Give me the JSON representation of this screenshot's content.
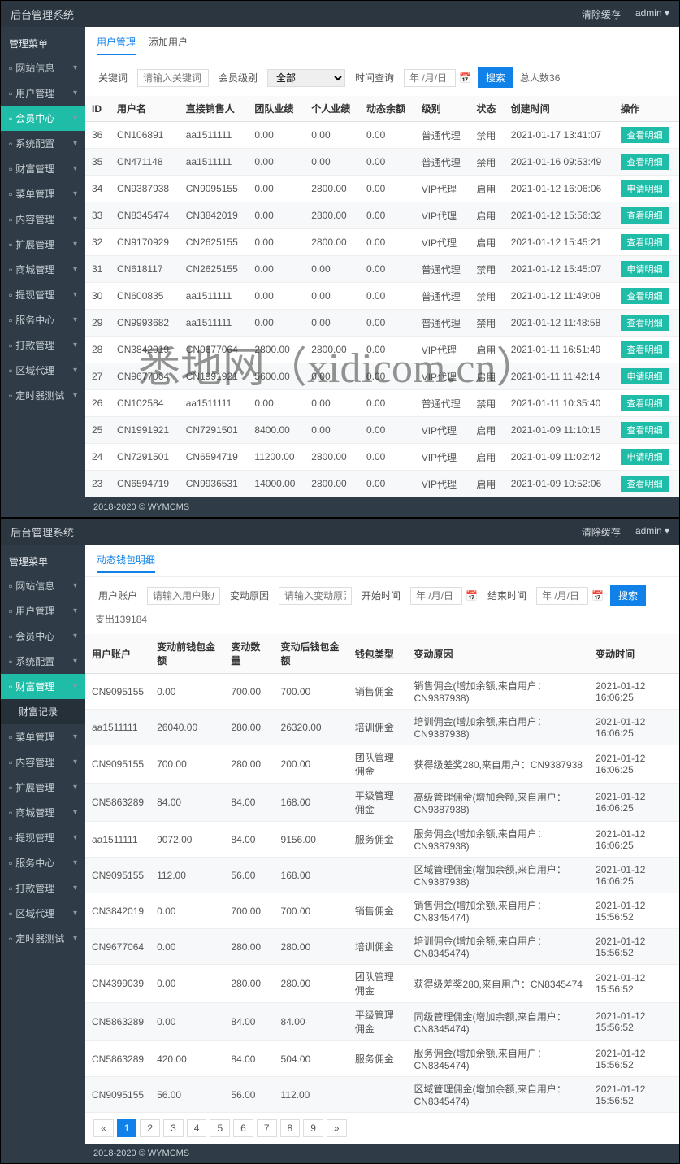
{
  "watermark": "悉地网（xidicom.cn）",
  "topbar": {
    "title": "后台管理系统",
    "clear": "清除缓存",
    "user": "admin"
  },
  "sidebar1": {
    "header": "管理菜单",
    "items": [
      {
        "label": "网站信息",
        "icon": "home-icon"
      },
      {
        "label": "用户管理",
        "icon": "users-icon"
      },
      {
        "label": "会员中心",
        "icon": "member-icon",
        "active": true
      },
      {
        "label": "系统配置",
        "icon": "cog-icon"
      },
      {
        "label": "财富管理",
        "icon": "chart-icon"
      },
      {
        "label": "菜单管理",
        "icon": "list-icon"
      },
      {
        "label": "内容管理",
        "icon": "doc-icon"
      },
      {
        "label": "扩展管理",
        "icon": "plug-icon"
      },
      {
        "label": "商城管理",
        "icon": "cart-icon"
      },
      {
        "label": "提现管理",
        "icon": "money-icon"
      },
      {
        "label": "服务中心",
        "icon": "service-icon"
      },
      {
        "label": "打款管理",
        "icon": "bank-icon"
      },
      {
        "label": "区域代理",
        "icon": "map-icon"
      },
      {
        "label": "定时器测试",
        "icon": "clock-icon"
      }
    ]
  },
  "page1": {
    "tabs": [
      {
        "label": "用户管理",
        "active": true
      },
      {
        "label": "添加用户"
      }
    ],
    "filter": {
      "keyword_label": "关键词",
      "keyword_placeholder": "请输入关键词",
      "level_label": "会员级别",
      "level_value": "全部",
      "time_label": "时间查询",
      "time_placeholder": "年 /月/日",
      "search": "搜索",
      "total": "总人数36"
    },
    "columns": [
      "ID",
      "用户名",
      "直接销售人",
      "团队业绩",
      "个人业绩",
      "动态余额",
      "级别",
      "状态",
      "创建时间",
      "操作"
    ],
    "rows": [
      {
        "id": "36",
        "user": "CN106891",
        "ref": "aa1511111",
        "team": "0.00",
        "pers": "0.00",
        "bal": "0.00",
        "lvl": "普通代理",
        "status": "禁用",
        "time": "2021-01-17 13:41:07",
        "op": "查看明细"
      },
      {
        "id": "35",
        "user": "CN471148",
        "ref": "aa1511111",
        "team": "0.00",
        "pers": "0.00",
        "bal": "0.00",
        "lvl": "普通代理",
        "status": "禁用",
        "time": "2021-01-16 09:53:49",
        "op": "查看明细"
      },
      {
        "id": "34",
        "user": "CN9387938",
        "ref": "CN9095155",
        "team": "0.00",
        "pers": "2800.00",
        "bal": "0.00",
        "lvl": "VIP代理",
        "status": "启用",
        "time": "2021-01-12 16:06:06",
        "op": "申请明细"
      },
      {
        "id": "33",
        "user": "CN8345474",
        "ref": "CN3842019",
        "team": "0.00",
        "pers": "2800.00",
        "bal": "0.00",
        "lvl": "VIP代理",
        "status": "启用",
        "time": "2021-01-12 15:56:32",
        "op": "查看明细"
      },
      {
        "id": "32",
        "user": "CN9170929",
        "ref": "CN2625155",
        "team": "0.00",
        "pers": "2800.00",
        "bal": "0.00",
        "lvl": "VIP代理",
        "status": "启用",
        "time": "2021-01-12 15:45:21",
        "op": "查看明细"
      },
      {
        "id": "31",
        "user": "CN618117",
        "ref": "CN2625155",
        "team": "0.00",
        "pers": "0.00",
        "bal": "0.00",
        "lvl": "普通代理",
        "status": "禁用",
        "time": "2021-01-12 15:45:07",
        "op": "申请明细"
      },
      {
        "id": "30",
        "user": "CN600835",
        "ref": "aa1511111",
        "team": "0.00",
        "pers": "0.00",
        "bal": "0.00",
        "lvl": "普通代理",
        "status": "禁用",
        "time": "2021-01-12 11:49:08",
        "op": "查看明细"
      },
      {
        "id": "29",
        "user": "CN9993682",
        "ref": "aa1511111",
        "team": "0.00",
        "pers": "0.00",
        "bal": "0.00",
        "lvl": "普通代理",
        "status": "禁用",
        "time": "2021-01-12 11:48:58",
        "op": "查看明细"
      },
      {
        "id": "28",
        "user": "CN3842019",
        "ref": "CN9677064",
        "team": "2800.00",
        "pers": "2800.00",
        "bal": "0.00",
        "lvl": "VIP代理",
        "status": "启用",
        "time": "2021-01-11 16:51:49",
        "op": "查看明细"
      },
      {
        "id": "27",
        "user": "CN9677064",
        "ref": "CN1991921",
        "team": "5600.00",
        "pers": "0.00",
        "bal": "0.00",
        "lvl": "VIP代理",
        "status": "启用",
        "time": "2021-01-11 11:42:14",
        "op": "申请明细"
      },
      {
        "id": "26",
        "user": "CN102584",
        "ref": "aa1511111",
        "team": "0.00",
        "pers": "0.00",
        "bal": "0.00",
        "lvl": "普通代理",
        "status": "禁用",
        "time": "2021-01-11 10:35:40",
        "op": "查看明细"
      },
      {
        "id": "25",
        "user": "CN1991921",
        "ref": "CN7291501",
        "team": "8400.00",
        "pers": "0.00",
        "bal": "0.00",
        "lvl": "VIP代理",
        "status": "启用",
        "time": "2021-01-09 11:10:15",
        "op": "查看明细"
      },
      {
        "id": "24",
        "user": "CN7291501",
        "ref": "CN6594719",
        "team": "11200.00",
        "pers": "2800.00",
        "bal": "0.00",
        "lvl": "VIP代理",
        "status": "启用",
        "time": "2021-01-09 11:02:42",
        "op": "申请明细"
      },
      {
        "id": "23",
        "user": "CN6594719",
        "ref": "CN9936531",
        "team": "14000.00",
        "pers": "2800.00",
        "bal": "0.00",
        "lvl": "VIP代理",
        "status": "启用",
        "time": "2021-01-09 10:52:06",
        "op": "查看明细"
      }
    ],
    "footer": "2018-2020 © WYMCMS"
  },
  "sidebar2": {
    "header": "管理菜单",
    "items": [
      {
        "label": "网站信息",
        "icon": "home-icon"
      },
      {
        "label": "用户管理",
        "icon": "users-icon"
      },
      {
        "label": "会员中心",
        "icon": "member-icon"
      },
      {
        "label": "系统配置",
        "icon": "cog-icon"
      },
      {
        "label": "财富管理",
        "icon": "chart-icon",
        "active": true
      },
      {
        "label": "菜单管理",
        "icon": "list-icon"
      },
      {
        "label": "内容管理",
        "icon": "doc-icon"
      },
      {
        "label": "扩展管理",
        "icon": "plug-icon"
      },
      {
        "label": "商城管理",
        "icon": "cart-icon"
      },
      {
        "label": "提现管理",
        "icon": "money-icon"
      },
      {
        "label": "服务中心",
        "icon": "service-icon"
      },
      {
        "label": "打款管理",
        "icon": "bank-icon"
      },
      {
        "label": "区域代理",
        "icon": "map-icon"
      },
      {
        "label": "定时器测试",
        "icon": "clock-icon"
      }
    ],
    "sub": "财富记录"
  },
  "page2": {
    "tabs": [
      {
        "label": "动态钱包明细",
        "active": true
      }
    ],
    "filter": {
      "account_label": "用户账户",
      "account_placeholder": "请输入用户账户",
      "reason_label": "变动原因",
      "reason_placeholder": "请输入变动原因",
      "start_label": "开始时间",
      "time_placeholder": "年 /月/日",
      "end_label": "结束时间",
      "search": "搜索",
      "total": "支出139184"
    },
    "columns": [
      "用户账户",
      "变动前钱包金额",
      "变动数量",
      "变动后钱包金额",
      "钱包类型",
      "变动原因",
      "变动时间"
    ],
    "rows": [
      {
        "u": "CN9095155",
        "before": "0.00",
        "diff": "700.00",
        "after": "700.00",
        "type": "销售佣金",
        "reason": "销售佣金(增加余额,来自用户：CN9387938)",
        "time": "2021-01-12 16:06:25"
      },
      {
        "u": "aa1511111",
        "before": "26040.00",
        "diff": "280.00",
        "after": "26320.00",
        "type": "培训佣金",
        "reason": "培训佣金(增加余额,来自用户：CN9387938)",
        "time": "2021-01-12 16:06:25"
      },
      {
        "u": "CN9095155",
        "before": "700.00",
        "diff": "280.00",
        "after": "200.00",
        "type": "团队管理佣金",
        "reason": "获得级差奖280,来自用户：CN9387938",
        "time": "2021-01-12 16:06:25"
      },
      {
        "u": "CN5863289",
        "before": "84.00",
        "diff": "84.00",
        "after": "168.00",
        "type": "平级管理佣金",
        "reason": "高级管理佣金(增加余额,来自用户：CN9387938)",
        "time": "2021-01-12 16:06:25"
      },
      {
        "u": "aa1511111",
        "before": "9072.00",
        "diff": "84.00",
        "after": "9156.00",
        "type": "服务佣金",
        "reason": "服务佣金(增加余额,来自用户：CN9387938)",
        "time": "2021-01-12 16:06:25"
      },
      {
        "u": "CN9095155",
        "before": "112.00",
        "diff": "56.00",
        "after": "168.00",
        "type": "",
        "reason": "区域管理佣金(增加余额,来自用户：CN9387938)",
        "time": "2021-01-12 16:06:25"
      },
      {
        "u": "CN3842019",
        "before": "0.00",
        "diff": "700.00",
        "after": "700.00",
        "type": "销售佣金",
        "reason": "销售佣金(增加余额,来自用户：CN8345474)",
        "time": "2021-01-12 15:56:52"
      },
      {
        "u": "CN9677064",
        "before": "0.00",
        "diff": "280.00",
        "after": "280.00",
        "type": "培训佣金",
        "reason": "培训佣金(增加余额,来自用户：CN8345474)",
        "time": "2021-01-12 15:56:52"
      },
      {
        "u": "CN4399039",
        "before": "0.00",
        "diff": "280.00",
        "after": "280.00",
        "type": "团队管理佣金",
        "reason": "获得级差奖280,来自用户：CN8345474",
        "time": "2021-01-12 15:56:52"
      },
      {
        "u": "CN5863289",
        "before": "0.00",
        "diff": "84.00",
        "after": "84.00",
        "type": "平级管理佣金",
        "reason": "同级管理佣金(增加余额,来自用户：CN8345474)",
        "time": "2021-01-12 15:56:52"
      },
      {
        "u": "CN5863289",
        "before": "420.00",
        "diff": "84.00",
        "after": "504.00",
        "type": "服务佣金",
        "reason": "服务佣金(增加余额,来自用户：CN8345474)",
        "time": "2021-01-12 15:56:52"
      },
      {
        "u": "CN9095155",
        "before": "56.00",
        "diff": "56.00",
        "after": "112.00",
        "type": "",
        "reason": "区域管理佣金(增加余额,来自用户：CN8345474)",
        "time": "2021-01-12 15:56:52"
      }
    ],
    "pages": [
      "«",
      "1",
      "2",
      "3",
      "4",
      "5",
      "6",
      "7",
      "8",
      "9",
      "»"
    ],
    "active_page": "1",
    "footer": "2018-2020 © WYMCMS"
  }
}
